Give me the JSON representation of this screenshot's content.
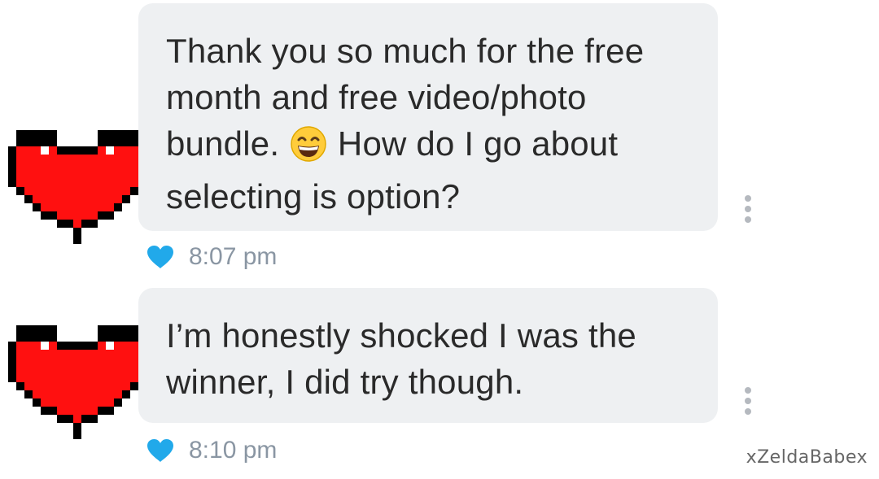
{
  "colors": {
    "bubble": "#eef0f2",
    "text": "#2a2a2a",
    "timestamp": "#8a96a3",
    "like_heart": "#21a9ea",
    "avatar_heart": "#ff1010",
    "more_dots": "#b5b9bf"
  },
  "messages": [
    {
      "avatar_icon": "pixel-heart-icon",
      "text_before_emoji": "Thank you so much for the free\nmonth and free video/photo\nbundle. ",
      "emoji_icon": "grinning-squinting-face-emoji",
      "text_after_emoji": " How do I go about\nselecting is option?",
      "liked_icon": "heart-icon",
      "time": "8:07 pm",
      "menu_icon": "more-vertical-icon"
    },
    {
      "avatar_icon": "pixel-heart-icon",
      "text": "I’m honestly shocked I was the\nwinner, I did try though.",
      "liked_icon": "heart-icon",
      "time": "8:10 pm",
      "menu_icon": "more-vertical-icon"
    }
  ],
  "watermark": "xZeldaBabex"
}
